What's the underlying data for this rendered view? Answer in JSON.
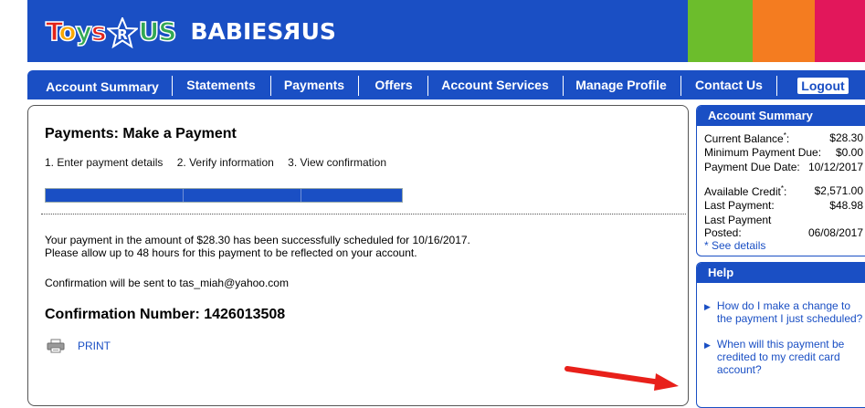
{
  "header": {
    "logo_toys_parts": [
      "T",
      "o",
      "y",
      "s"
    ],
    "logo_r": "R",
    "logo_us": "US",
    "logo_babies": "BABIES",
    "logo_babies_us": "US",
    "stripe_colors": [
      "#6cbd2c",
      "#f47c20",
      "#e2175b"
    ],
    "brand_color": "#1a4fc4"
  },
  "nav": {
    "items": [
      "Account Summary",
      "Statements",
      "Payments",
      "Offers",
      "Account Services",
      "Manage Profile",
      "Contact Us"
    ],
    "logout_label": "Logout"
  },
  "main": {
    "title": "Payments: Make a Payment",
    "steps": [
      "1. Enter payment details",
      "2. Verify information",
      "3. View confirmation"
    ],
    "progress_fraction": 1.0,
    "message_line1": "Your payment in the amount of $28.30 has been successfully scheduled for 10/16/2017.",
    "message_line2": "Please allow up to 48 hours for this payment to be reflected on your account.",
    "confirmation_email_text": "Confirmation will be sent to tas_miah@yahoo.com",
    "confirmation_number_text": "Confirmation Number: 1426013508",
    "print_label": "PRINT",
    "print_icon": "printer-icon"
  },
  "sidebar": {
    "summary": {
      "title": "Account Summary",
      "current_balance_label": "Current Balance",
      "current_balance_mark": "*",
      "current_balance_colon": ":",
      "current_balance": "$28.30",
      "minimum_payment_label": "Minimum Payment Due:",
      "minimum_payment": "$0.00",
      "due_date_label": "Payment Due Date:",
      "due_date": "10/12/2017",
      "available_credit_label": "Available Credit",
      "available_credit_mark": "*",
      "available_credit_colon": ":",
      "available_credit": "$2,571.00",
      "last_payment_label": "Last Payment:",
      "last_payment": "$48.98",
      "last_posted_label_1": "Last Payment",
      "last_posted_label_2": "Posted:",
      "last_posted": "06/08/2017",
      "see_details": "* See details"
    },
    "help": {
      "title": "Help",
      "links": [
        [
          "How do I make a change to",
          "the payment I just scheduled?"
        ],
        [
          "When will this payment be",
          "credited to my credit card",
          "account?"
        ]
      ]
    }
  },
  "annotation": {
    "arrow_color": "#e8201a"
  }
}
